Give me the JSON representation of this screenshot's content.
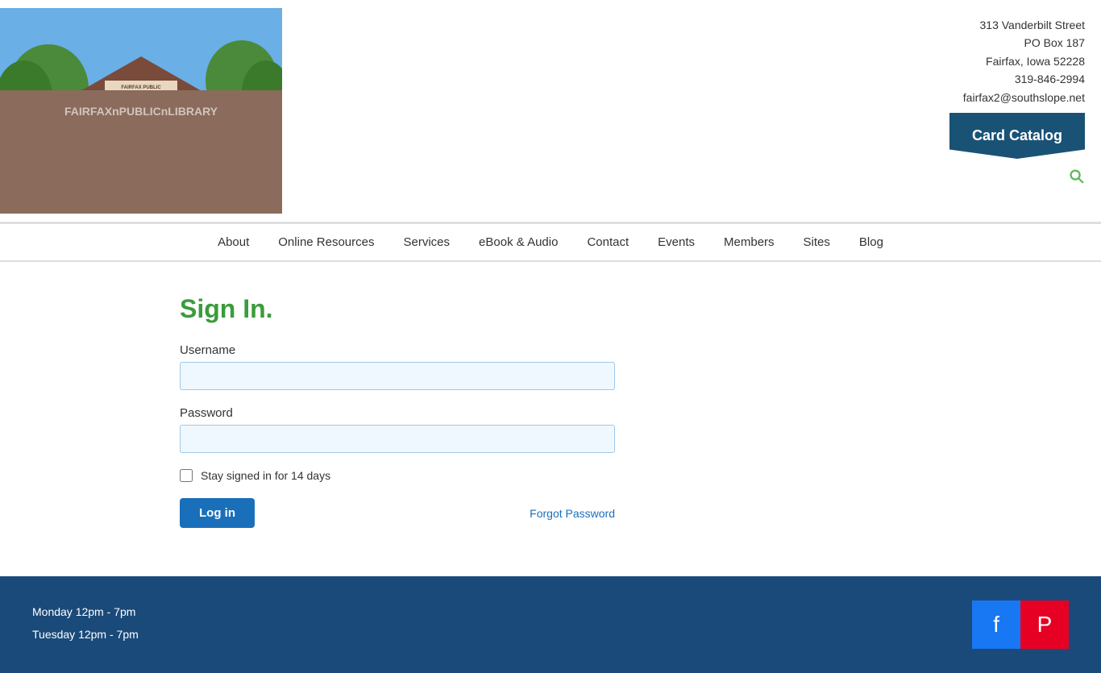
{
  "header": {
    "address_line1": "313 Vanderbilt Street",
    "address_line2": "PO Box 187",
    "address_line3": "Fairfax, Iowa 52228",
    "phone": "319-846-2994",
    "email": "fairfax2@southslope.net",
    "card_catalog_label": "Card Catalog"
  },
  "nav": {
    "items": [
      {
        "label": "About",
        "href": "#"
      },
      {
        "label": "Online Resources",
        "href": "#"
      },
      {
        "label": "Services",
        "href": "#"
      },
      {
        "label": "eBook & Audio",
        "href": "#"
      },
      {
        "label": "Contact",
        "href": "#"
      },
      {
        "label": "Events",
        "href": "#"
      },
      {
        "label": "Members",
        "href": "#"
      },
      {
        "label": "Sites",
        "href": "#"
      },
      {
        "label": "Blog",
        "href": "#"
      }
    ]
  },
  "sign_in": {
    "title": "Sign In.",
    "username_label": "Username",
    "username_placeholder": "",
    "password_label": "Password",
    "password_placeholder": "",
    "stay_signed_label": "Stay signed in for 14 days",
    "log_in_button": "Log in",
    "forgot_password_link": "Forgot Password"
  },
  "footer": {
    "hours": [
      "Monday 12pm - 7pm",
      "Tuesday 12pm - 7pm"
    ]
  }
}
